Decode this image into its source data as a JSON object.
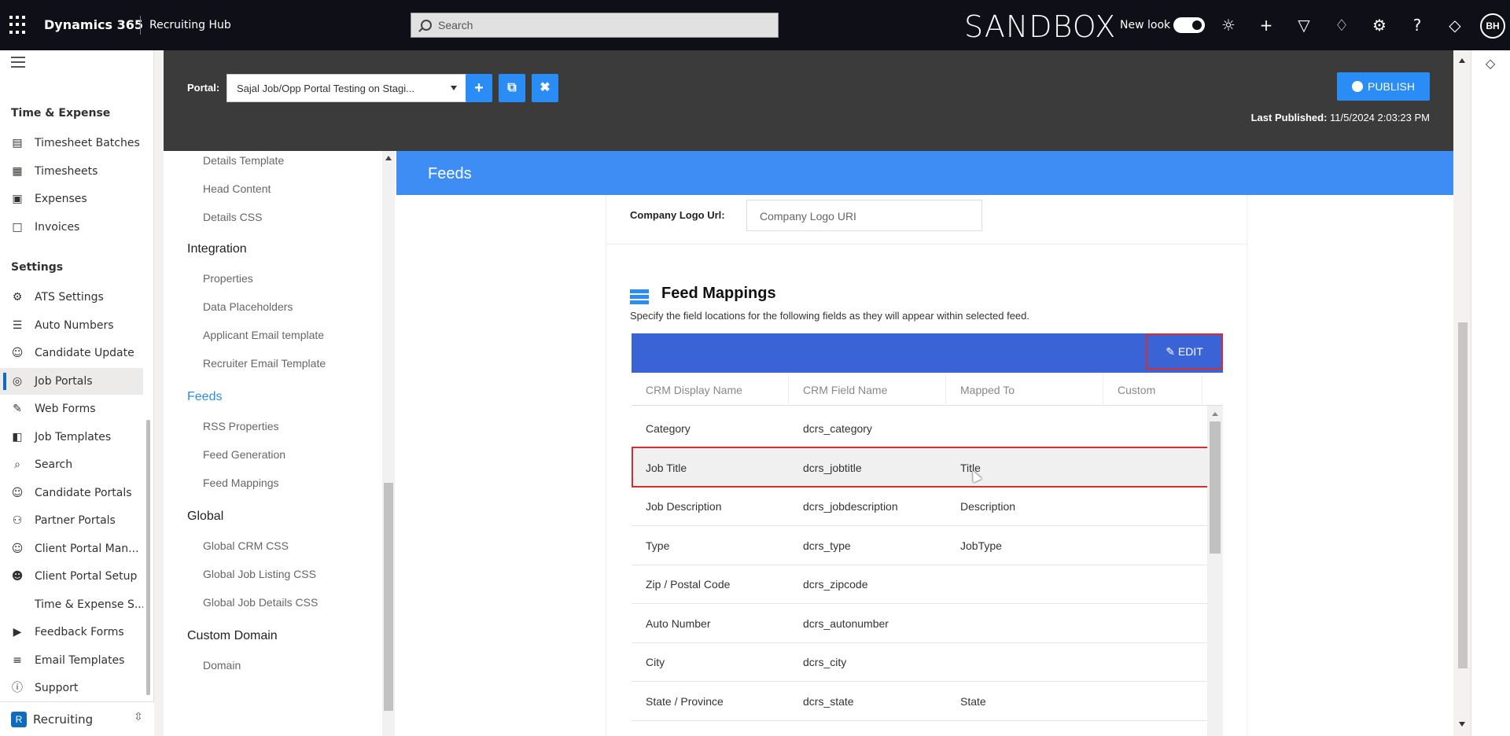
{
  "topbar": {
    "brand": "Dynamics 365",
    "app_name": "Recruiting Hub",
    "search_placeholder": "Search",
    "environment": "SANDBOX",
    "new_look_label": "New look",
    "new_look_on": true,
    "avatar_initials": "BH",
    "icons": [
      "lightbulb-icon",
      "plus-icon",
      "filter-icon",
      "bell-icon",
      "gear-icon",
      "help-icon",
      "copilot-icon"
    ]
  },
  "leftnav": {
    "section1": "Time & Expense",
    "items1": [
      {
        "label": "Timesheet Batches",
        "icon": "calendar-icon"
      },
      {
        "label": "Timesheets",
        "icon": "timesheet-icon"
      },
      {
        "label": "Expenses",
        "icon": "receipt-icon"
      },
      {
        "label": "Invoices",
        "icon": "invoice-icon"
      }
    ],
    "section2": "Settings",
    "items2": [
      {
        "label": "ATS Settings",
        "icon": "gear-icon"
      },
      {
        "label": "Auto Numbers",
        "icon": "list-icon"
      },
      {
        "label": "Candidate Update",
        "icon": "people-icon"
      },
      {
        "label": "Job Portals",
        "icon": "globe-icon",
        "active": true
      },
      {
        "label": "Web Forms",
        "icon": "form-icon"
      },
      {
        "label": "Job Templates",
        "icon": "template-icon"
      },
      {
        "label": "Search",
        "icon": "search-people-icon"
      },
      {
        "label": "Candidate Portals",
        "icon": "people-icon"
      },
      {
        "label": "Partner Portals",
        "icon": "partners-icon"
      },
      {
        "label": "Client Portal Man...",
        "icon": "people-icon"
      },
      {
        "label": "Client Portal Setup",
        "icon": "person-setup-icon"
      },
      {
        "label": "Time & Expense S...",
        "icon": ""
      },
      {
        "label": "Feedback Forms",
        "icon": "feedback-icon"
      },
      {
        "label": "Email Templates",
        "icon": "email-template-icon"
      },
      {
        "label": "Support",
        "icon": "help-circle-icon"
      }
    ],
    "area": {
      "badge": "R",
      "label": "Recruiting"
    }
  },
  "portal": {
    "label": "Portal:",
    "selected": "Sajal Job/Opp Portal Testing on Stagi...",
    "publish_label": "PUBLISH",
    "last_published_label": "Last Published:",
    "last_published_value": "11/5/2024 2:03:23 PM"
  },
  "editor_nav": {
    "items": [
      {
        "type": "sub",
        "label": "Details Template"
      },
      {
        "type": "sub",
        "label": "Head Content"
      },
      {
        "type": "sub",
        "label": "Details CSS"
      },
      {
        "type": "group",
        "label": "Integration"
      },
      {
        "type": "sub",
        "label": "Properties"
      },
      {
        "type": "sub",
        "label": "Data Placeholders"
      },
      {
        "type": "sub",
        "label": "Applicant Email template"
      },
      {
        "type": "sub",
        "label": "Recruiter Email Template"
      },
      {
        "type": "group",
        "label": "Feeds",
        "active": true
      },
      {
        "type": "sub",
        "label": "RSS Properties"
      },
      {
        "type": "sub",
        "label": "Feed Generation"
      },
      {
        "type": "sub",
        "label": "Feed Mappings"
      },
      {
        "type": "group",
        "label": "Global"
      },
      {
        "type": "sub",
        "label": "Global CRM CSS"
      },
      {
        "type": "sub",
        "label": "Global Job Listing CSS"
      },
      {
        "type": "sub",
        "label": "Global Job Details CSS"
      },
      {
        "type": "group",
        "label": "Custom Domain"
      },
      {
        "type": "sub",
        "label": "Domain"
      }
    ]
  },
  "feeds": {
    "title": "Feeds",
    "company_logo_label": "Company Logo Url:",
    "company_logo_placeholder": "Company Logo URI",
    "mappings_title": "Feed Mappings",
    "mappings_desc": "Specify the field locations for the following fields as they will appear within selected feed.",
    "edit_label": "EDIT",
    "columns": [
      "CRM Display Name",
      "CRM Field Name",
      "Mapped To",
      "Custom"
    ],
    "rows": [
      [
        "Category",
        "dcrs_category",
        "",
        ""
      ],
      [
        "Job Title",
        "dcrs_jobtitle",
        "Title",
        ""
      ],
      [
        "Job Description",
        "dcrs_jobdescription",
        "Description",
        ""
      ],
      [
        "Type",
        "dcrs_type",
        "JobType",
        ""
      ],
      [
        "Zip / Postal Code",
        "dcrs_zipcode",
        "",
        ""
      ],
      [
        "Auto Number",
        "dcrs_autonumber",
        "",
        ""
      ],
      [
        "City",
        "dcrs_city",
        "",
        ""
      ],
      [
        "State / Province",
        "dcrs_state",
        "State",
        ""
      ]
    ],
    "selected_row": 1
  },
  "colors": {
    "topbar": "#0f0f17",
    "accent": "#2a8cf5",
    "table_header": "#3a63d6",
    "highlight": "#d32f2f"
  }
}
